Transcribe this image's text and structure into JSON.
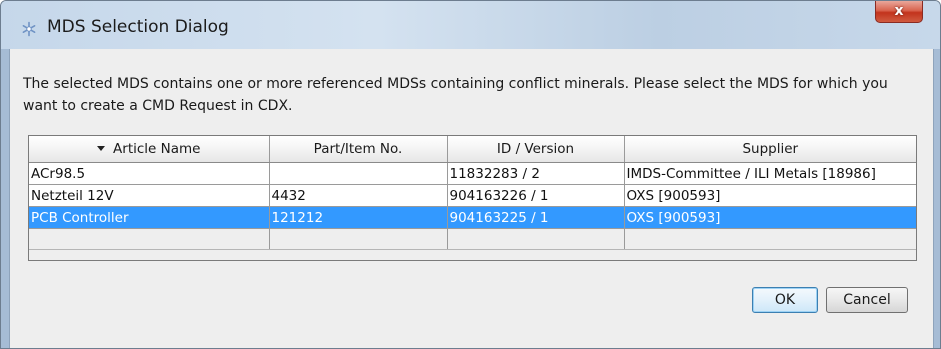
{
  "window": {
    "title": "MDS Selection Dialog",
    "close_glyph": "x",
    "icon": "snowflake-icon"
  },
  "message": "The selected MDS contains one or more referenced MDSs containing conflict minerals. Please select the MDS for which you want to create a CMD Request in CDX.",
  "table": {
    "columns": [
      "Article Name",
      "Part/Item No.",
      "ID / Version",
      "Supplier"
    ],
    "sort_column": "Article Name",
    "sort_direction": "descending",
    "rows": [
      {
        "article": "ACr98.5",
        "part": "",
        "id": "11832283 / 2",
        "supplier": "IMDS-Committee / ILI Metals [18986]"
      },
      {
        "article": "Netzteil 12V",
        "part": "4432",
        "id": "904163226 / 1",
        "supplier": "OXS [900593]"
      },
      {
        "article": "PCB Controller",
        "part": "121212",
        "id": "904163225 / 1",
        "supplier": "OXS [900593]"
      }
    ],
    "selected_row": 2
  },
  "buttons": {
    "ok": "OK",
    "cancel": "Cancel"
  },
  "colors": {
    "selection": "#3399ff",
    "titlebar": "#c5d7ea",
    "close_button": "#c2331c",
    "client_bg": "#eeeeee"
  }
}
